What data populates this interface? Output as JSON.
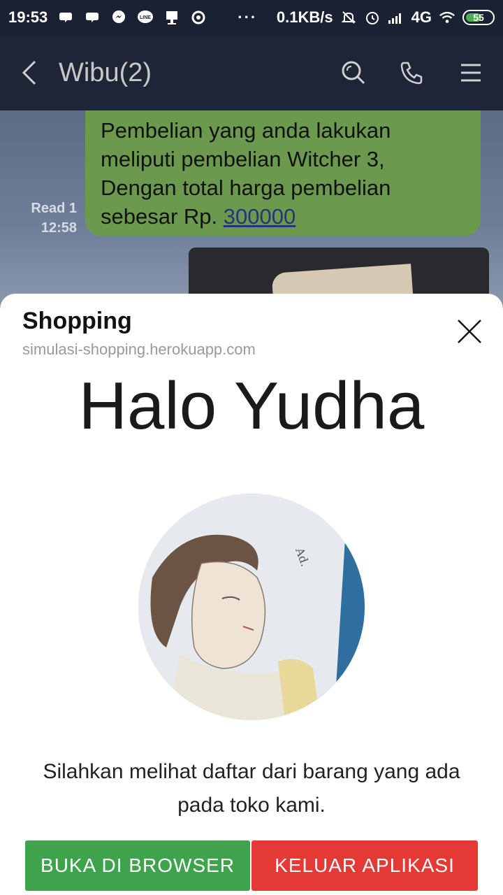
{
  "status_bar": {
    "time": "19:53",
    "dots": "···",
    "net_speed": "0.1KB/s",
    "network": "4G",
    "battery": "55"
  },
  "header": {
    "title": "Wibu(2)"
  },
  "chat": {
    "message_lines": [
      "Pembelian yang anda lakukan",
      "meliputi pembelian Witcher 3,",
      "Dengan total harga pembelian"
    ],
    "message_last_prefix": "sebesar Rp. ",
    "message_amount": "300000",
    "read_status": "Read 1",
    "read_time": "12:58"
  },
  "sheet": {
    "title": "Shopping",
    "url": "simulasi-shopping.herokuapp.com",
    "greeting": "Halo Yudha",
    "description_line1": "Silahkan melihat daftar dari barang yang ada",
    "description_line2": "pada toko kami.",
    "browser_button": "BUKA DI BROWSER",
    "exit_button": "KELUAR APLIKASI"
  },
  "colors": {
    "browser_button": "#3fa34d",
    "exit_button": "#e53935",
    "bubble": "#6b9a4f"
  }
}
